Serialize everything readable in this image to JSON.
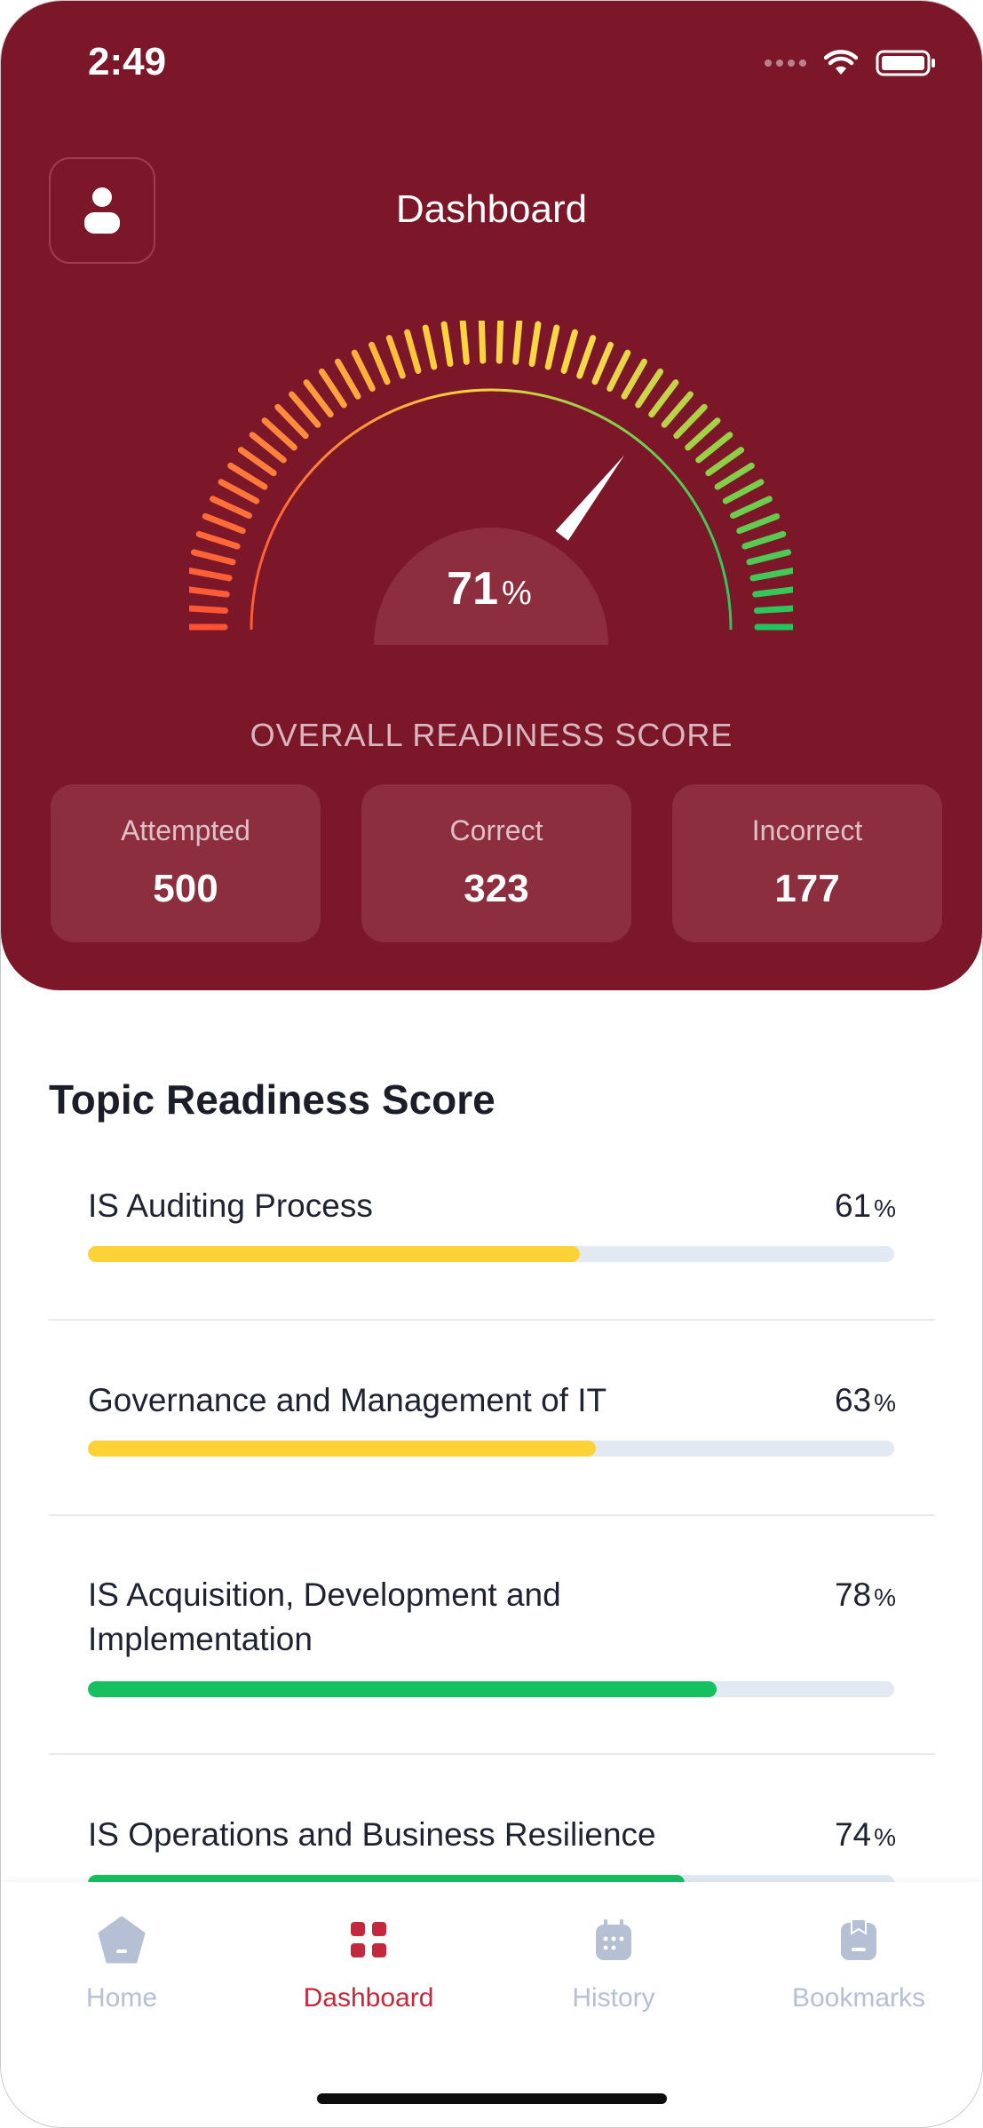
{
  "status": {
    "time": "2:49"
  },
  "header": {
    "title": "Dashboard"
  },
  "gauge": {
    "value": 71,
    "value_text": "71",
    "unit": "%",
    "label": "OVERALL READINESS SCORE"
  },
  "stats": [
    {
      "label": "Attempted",
      "value": "500"
    },
    {
      "label": "Correct",
      "value": "323"
    },
    {
      "label": "Incorrect",
      "value": "177"
    }
  ],
  "section": {
    "title": "Topic Readiness Score"
  },
  "topics": [
    {
      "name": "IS Auditing Process",
      "value": 61,
      "value_text": "61",
      "unit": "%",
      "color": "#fdd237"
    },
    {
      "name": "Governance and Management of IT",
      "value": 63,
      "value_text": "63",
      "unit": "%",
      "color": "#fdd237"
    },
    {
      "name": "IS Acquisition, Development and Implementation",
      "value": 78,
      "value_text": "78",
      "unit": "%",
      "color": "#16bf5f"
    },
    {
      "name": "IS Operations and Business Resilience",
      "value": 74,
      "value_text": "74",
      "unit": "%",
      "color": "#16bf5f"
    }
  ],
  "tabs": [
    {
      "label": "Home",
      "icon": "home-icon",
      "active": false
    },
    {
      "label": "Dashboard",
      "icon": "dashboard-grid-icon",
      "active": true
    },
    {
      "label": "History",
      "icon": "history-calendar-icon",
      "active": false
    },
    {
      "label": "Bookmarks",
      "icon": "bookmark-clipboard-icon",
      "active": false
    }
  ],
  "colors": {
    "header_bg": "#7b1728",
    "accent": "#c4283d",
    "bar_yellow": "#fdd237",
    "bar_green": "#16bf5f",
    "bar_track": "#e3e9f2"
  }
}
